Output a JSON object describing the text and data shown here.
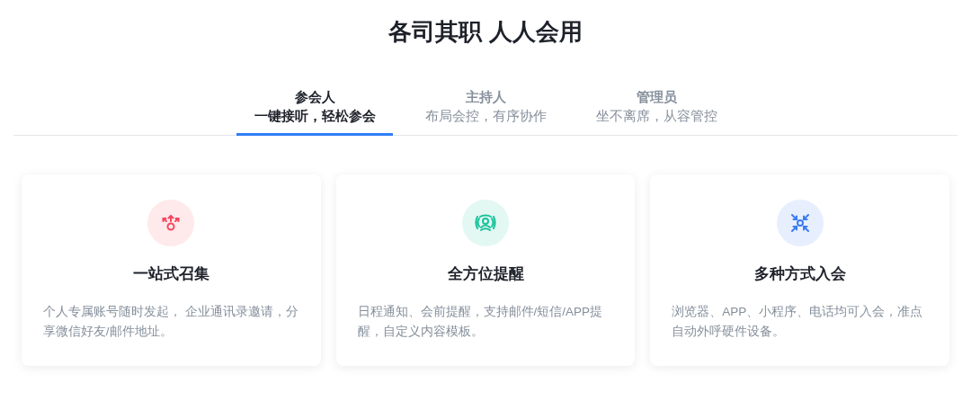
{
  "heading": "各司其职 人人会用",
  "tabs": [
    {
      "title": "参会人",
      "subtitle": "一键接听，轻松参会",
      "selected": true
    },
    {
      "title": "主持人",
      "subtitle": "布局会控，有序协作",
      "selected": false
    },
    {
      "title": "管理员",
      "subtitle": "坐不离席，从容管控",
      "selected": false
    }
  ],
  "cards": [
    {
      "kind": "spread",
      "color": "#f5475e",
      "title": "一站式召集",
      "description": "个人专属账号随时发起， 企业通讯录邀请，分享微信好友/邮件地址。"
    },
    {
      "kind": "signal",
      "color": "#19c29a",
      "title": "全方位提醒",
      "description": "日程通知、会前提醒，支持邮件/短信/APP提醒，自定义内容模板。"
    },
    {
      "kind": "converge",
      "color": "#3b7cf4",
      "title": "多种方式入会",
      "description": "浏览器、APP、小程序、电话均可入会，准点自动外呼硬件设备。"
    }
  ]
}
